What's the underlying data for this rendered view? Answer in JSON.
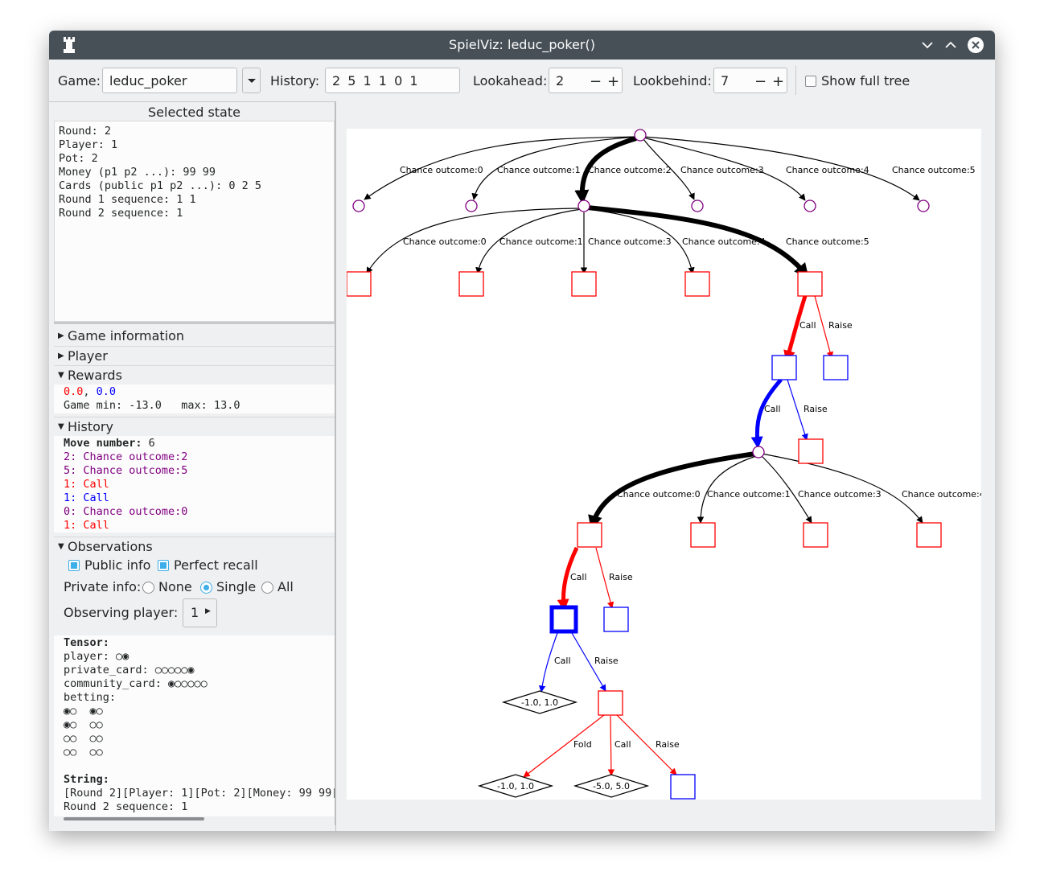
{
  "window": {
    "title": "SpielViz: leduc_poker()"
  },
  "toolbar": {
    "game_label": "Game:",
    "game_value": "leduc_poker",
    "history_label": "History:",
    "history_value": "2 5 1 1 0 1",
    "lookahead_label": "Lookahead:",
    "lookahead_value": "2",
    "lookbehind_label": "Lookbehind:",
    "lookbehind_value": "7",
    "minus": "−",
    "plus": "+",
    "show_full_tree_label": "Show full tree",
    "show_full_tree_checked": false
  },
  "selected_state": {
    "header": "Selected state",
    "lines": [
      "Round: 2",
      "Player: 1",
      "Pot: 2",
      "Money (p1 p2 ...): 99 99",
      "Cards (public p1 p2 ...): 0 2 5",
      "Round 1 sequence: 1 1",
      "Round 2 sequence: 1"
    ]
  },
  "sections": {
    "game_information": "Game information",
    "player": "Player",
    "rewards": "Rewards",
    "history": "History",
    "observations": "Observations"
  },
  "rewards": {
    "r0": "0.0",
    "comma": ", ",
    "r1": "0.0",
    "minmax": "Game min: -13.0   max: 13.0",
    "r0_color": "#ff0000",
    "r1_color": "#0000ff"
  },
  "history": {
    "move_label": "Move number:",
    "move_value": " 6",
    "moves": [
      {
        "text": "2: Chance outcome:2",
        "color": "#800080"
      },
      {
        "text": "5: Chance outcome:5",
        "color": "#800080"
      },
      {
        "text": "1: Call",
        "color": "#ff0000"
      },
      {
        "text": "1: Call",
        "color": "#0000ff"
      },
      {
        "text": "0: Chance outcome:0",
        "color": "#800080"
      },
      {
        "text": "1: Call",
        "color": "#ff0000"
      }
    ]
  },
  "observations": {
    "public_info_label": "Public info",
    "perfect_recall_label": "Perfect recall",
    "private_info_label": "Private info:",
    "opt_none": "None",
    "opt_single": "Single",
    "opt_all": "All",
    "observing_player_label": "Observing player:",
    "observing_player_value": "1",
    "tensor_lines": [
      {
        "t": "Tensor:",
        "bold": true
      },
      {
        "t": "player: ○◉"
      },
      {
        "t": "private_card: ○○○○○◉"
      },
      {
        "t": "community_card: ◉○○○○○"
      },
      {
        "t": "betting:"
      },
      {
        "t": "◉○  ◉○"
      },
      {
        "t": "◉○  ○○"
      },
      {
        "t": "○○  ○○"
      },
      {
        "t": "○○  ○○"
      },
      {
        "t": ""
      },
      {
        "t": "String:",
        "bold": true
      },
      {
        "t": "[Round 2][Player: 1][Pot: 2][Money: 99 99["
      },
      {
        "t": "Round 2 sequence: 1"
      }
    ]
  },
  "tree": {
    "edge_labels": {
      "co0": "Chance outcome:0",
      "co1": "Chance outcome:1",
      "co2": "Chance outcome:2",
      "co3": "Chance outcome:3",
      "co4": "Chance outcome:4",
      "co5": "Chance outcome:5",
      "call": "Call",
      "raise": "Raise",
      "fold": "Fold"
    },
    "terminals": {
      "t1": "-1.0, 1.0",
      "t2": "-1.0, 1.0",
      "t3": "-5.0, 5.0"
    },
    "colors": {
      "chance": "#800080",
      "player0": "#ff0000",
      "player1": "#0000ff",
      "path": "#000000"
    }
  }
}
